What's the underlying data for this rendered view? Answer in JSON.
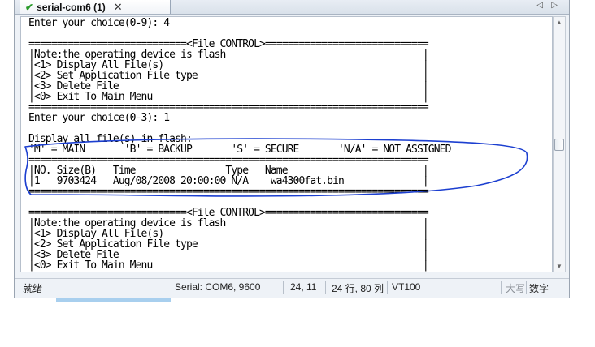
{
  "tab": {
    "title": "serial-com6 (1)",
    "close": "✕"
  },
  "nav": {
    "prev": "◁",
    "next": "▷"
  },
  "terminal_lines": [
    "Enter your choice(0-9): 4",
    "",
    "============================<File CONTROL>=============================",
    "|Note:the operating device is flash                                   |",
    "|<1> Display All File(s)                                              |",
    "|<2> Set Application File type                                        |",
    "|<3> Delete File                                                      |",
    "|<0> Exit To Main Menu                                                |",
    "=======================================================================",
    "Enter your choice(0-3): 1",
    "",
    "Display all file(s) in flash:",
    "'M' = MAIN       'B' = BACKUP       'S' = SECURE       'N/A' = NOT ASSIGNED",
    "=======================================================================",
    "|NO. Size(B)   Time                Type   Name                        |",
    "|1   9703424   Aug/08/2008 20:00:00 N/A    wa4300fat.bin              |",
    "=======================================================================",
    "",
    "============================<File CONTROL>=============================",
    "|Note:the operating device is flash                                   |",
    "|<1> Display All File(s)                                              |",
    "|<2> Set Application File type                                        |",
    "|<3> Delete File                                                      |",
    "|<0> Exit To Main Menu                                                |"
  ],
  "status": {
    "ready": "就绪",
    "serial": "Serial: COM6, 9600",
    "cursor": "24,  11",
    "size": "24 行, 80 列",
    "term": "VT100",
    "caps": "大写",
    "num": "数字"
  },
  "colors": {
    "annotation": "#1c3fd0",
    "accent": "#a8cfee"
  }
}
